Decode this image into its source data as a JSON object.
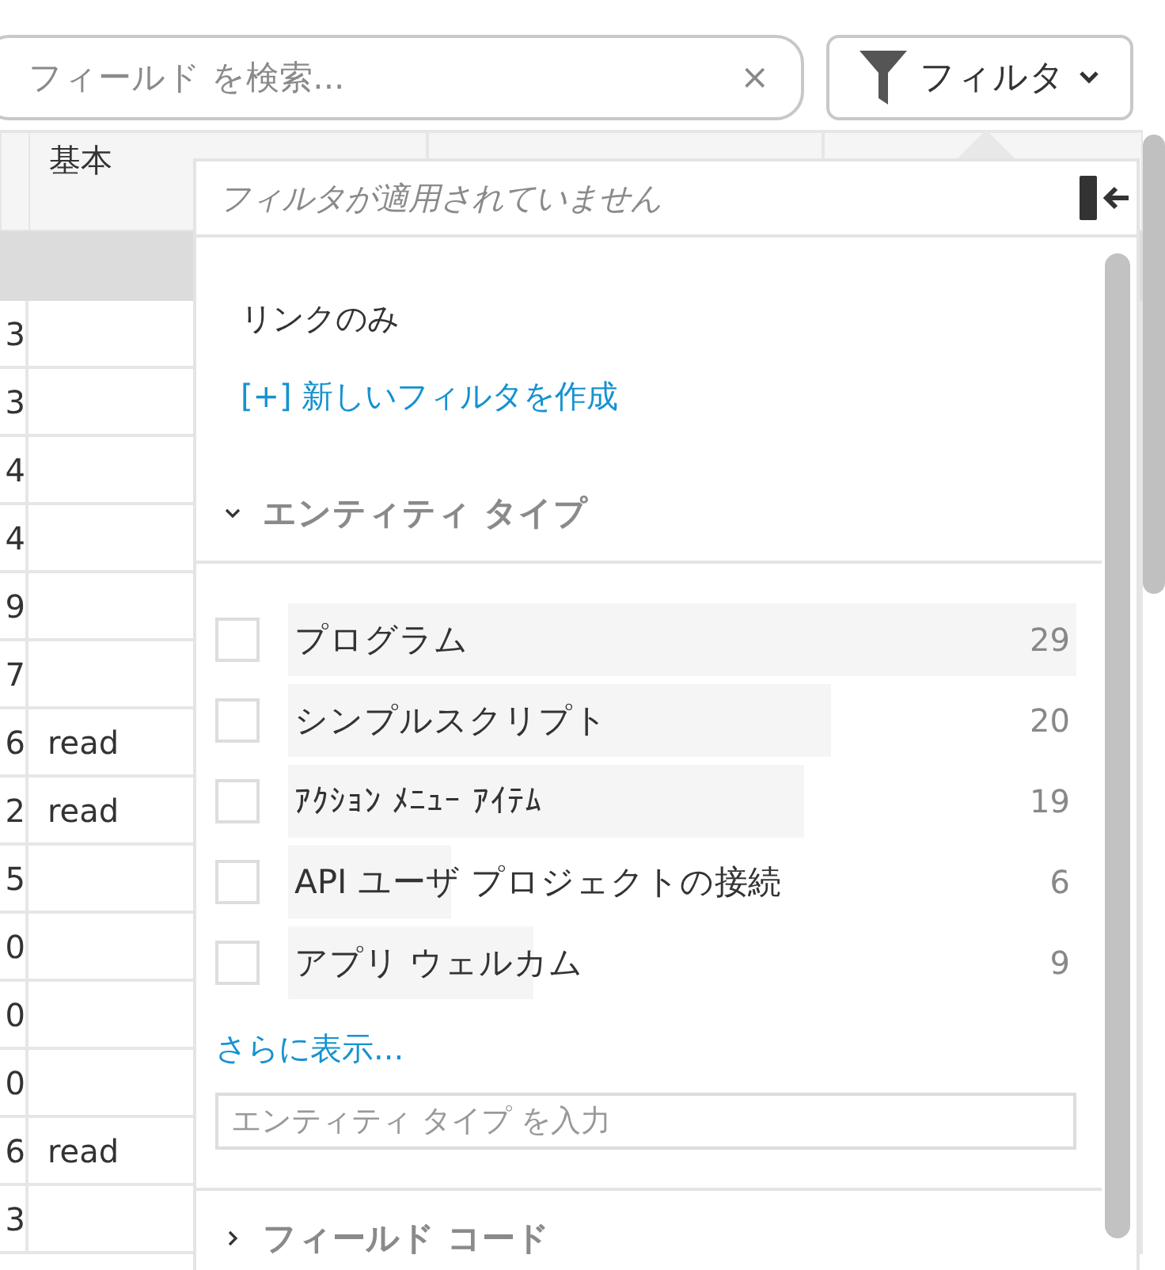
{
  "search": {
    "placeholder": "フィールド を検索...",
    "clear": "×"
  },
  "filter_button": {
    "label": "フィルタ"
  },
  "table": {
    "columns": [
      {
        "label": "基本"
      }
    ],
    "rows": [
      {
        "column_1": "3"
      },
      {
        "column_1": "3"
      },
      {
        "column_1": "4"
      },
      {
        "column_1": "4"
      },
      {
        "column_1": "9"
      },
      {
        "column_1": "7"
      },
      {
        "column_1": "6",
        "column_2": "read"
      },
      {
        "column_1": "2",
        "column_2": "read"
      },
      {
        "column_1": "5"
      },
      {
        "column_1": "0"
      },
      {
        "column_1": "0"
      },
      {
        "column_1": "0"
      },
      {
        "column_1": "6",
        "column_2": "read"
      },
      {
        "column_1": "3"
      }
    ]
  },
  "filter_panel": {
    "status": "フィルタが適用されていません",
    "links_only": "リンクのみ",
    "new_filter_link": "[+] 新しいフィルタを作成",
    "sections": [
      {
        "title": "エンティティ タイプ",
        "expanded": true,
        "items": [
          {
            "label": "プログラム",
            "count": "29",
            "checked": false
          },
          {
            "label": "シンプルスクリプト",
            "count": "20",
            "checked": false
          },
          {
            "label": "ｱｸｼｮﾝ ﾒﾆｭｰ ｱｲﾃﾑ",
            "count": "19",
            "checked": false
          },
          {
            "label": "API ユーザ プロジェクトの接続",
            "count": "6",
            "checked": false
          },
          {
            "label": "アプリ ウェルカム",
            "count": "9",
            "checked": false
          }
        ],
        "more_link": "さらに表示...",
        "input": {
          "placeholder": "エンティティ タイプ を入力"
        }
      },
      {
        "title": "フィールド コード",
        "expanded": false
      }
    ]
  }
}
